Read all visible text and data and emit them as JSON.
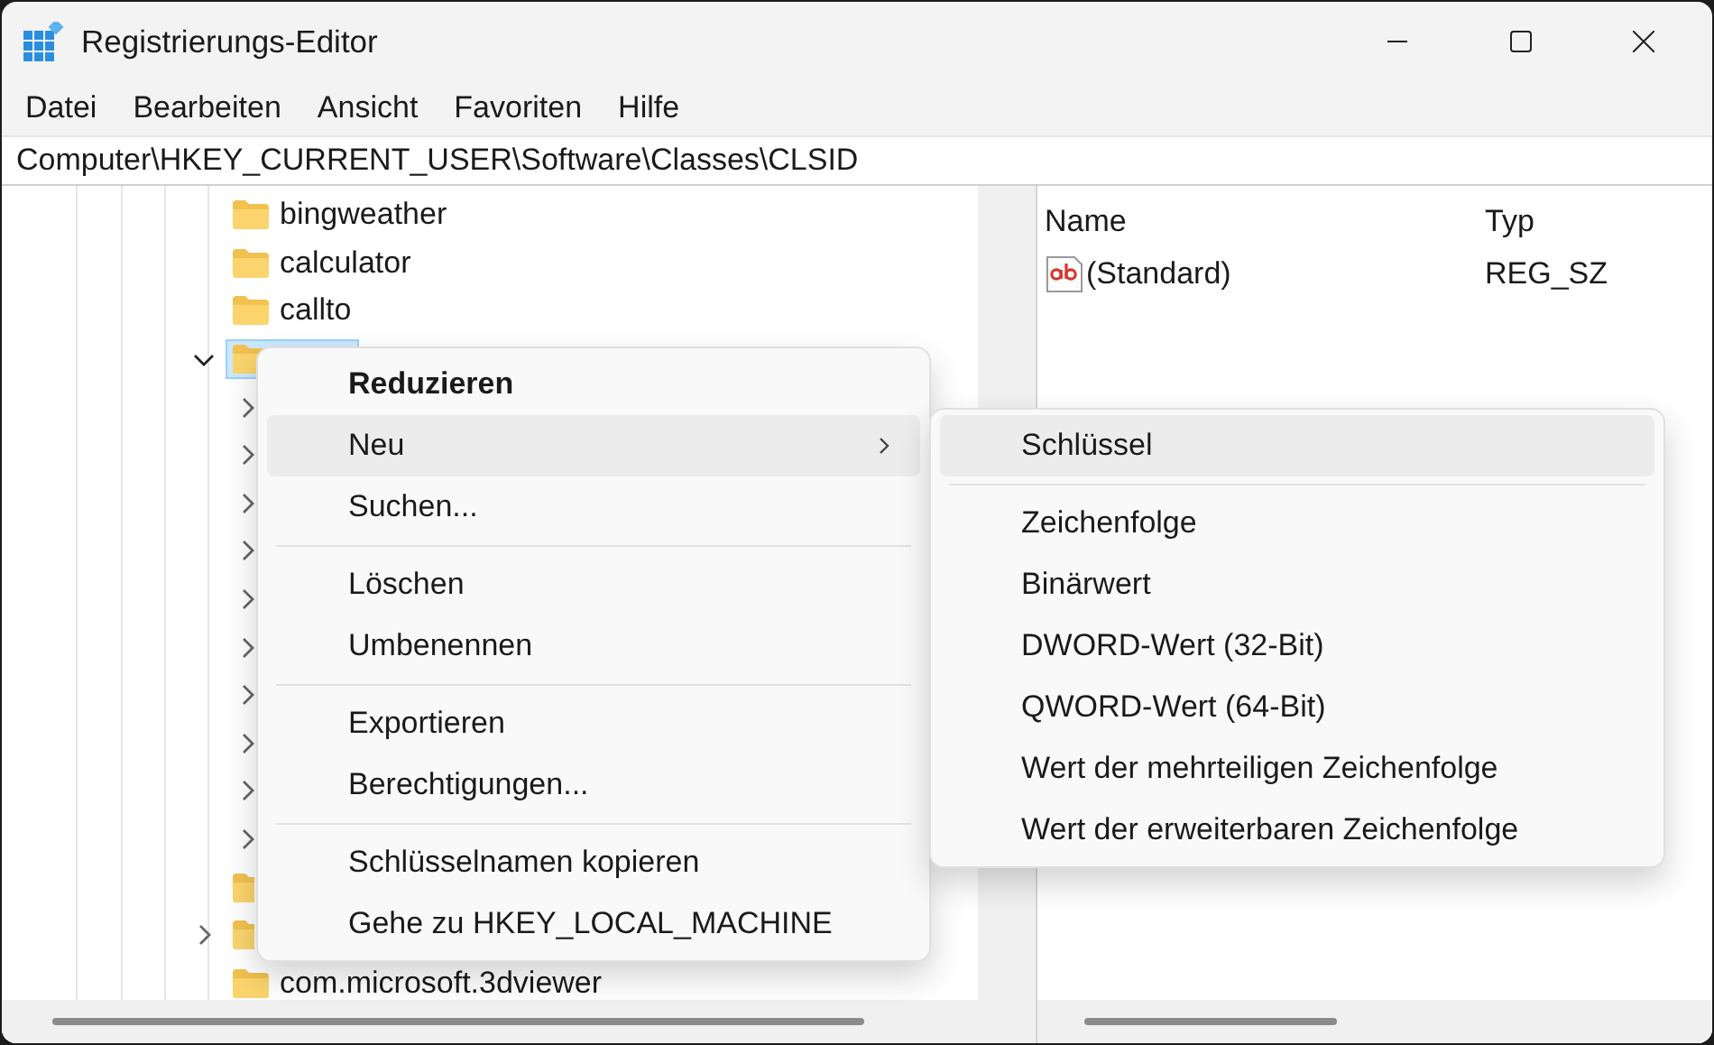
{
  "window": {
    "title": "Registrierungs-Editor"
  },
  "menu_bar": [
    "Datei",
    "Bearbeiten",
    "Ansicht",
    "Favoriten",
    "Hilfe"
  ],
  "address": "Computer\\HKEY_CURRENT_USER\\Software\\Classes\\CLSID",
  "tree": {
    "items": [
      {
        "label": "bingweather",
        "selected": false
      },
      {
        "label": "calculator",
        "selected": false
      },
      {
        "label": "callto",
        "selected": false
      },
      {
        "selected": true,
        "expanded": true,
        "children": [
          {
            "expanded": false
          },
          {
            "expanded": false
          },
          {
            "expanded": false
          },
          {
            "expanded": false
          },
          {
            "expanded": false
          },
          {
            "expanded": false
          },
          {
            "expanded": false
          },
          {
            "expanded": false
          },
          {
            "expanded": false
          },
          {
            "expanded": false
          }
        ]
      },
      {
        "selected": false
      },
      {
        "selected": false,
        "expanded": false
      },
      {
        "label": "com.microsoft.3dviewer",
        "selected": false
      }
    ]
  },
  "values": {
    "columns": [
      "Name",
      "Typ"
    ],
    "rows": [
      {
        "name": "(Standard)",
        "type": "REG_SZ"
      }
    ]
  },
  "context_menu": {
    "items": [
      {
        "kind": "item",
        "label": "Reduzieren",
        "default": true,
        "selected": false
      },
      {
        "kind": "item",
        "label": "Neu",
        "submenu": true,
        "selected": true
      },
      {
        "kind": "item",
        "label": "Suchen...",
        "selected": false
      },
      {
        "kind": "separator"
      },
      {
        "kind": "item",
        "label": "Löschen",
        "selected": false
      },
      {
        "kind": "item",
        "label": "Umbenennen",
        "selected": false
      },
      {
        "kind": "separator"
      },
      {
        "kind": "item",
        "label": "Exportieren",
        "selected": false
      },
      {
        "kind": "item",
        "label": "Berechtigungen...",
        "selected": false
      },
      {
        "kind": "separator"
      },
      {
        "kind": "item",
        "label": "Schlüsselnamen kopieren",
        "selected": false
      },
      {
        "kind": "item",
        "label": "Gehe zu HKEY_LOCAL_MACHINE",
        "selected": false
      }
    ]
  },
  "submenu": {
    "items": [
      {
        "kind": "item",
        "label": "Schlüssel",
        "selected": true
      },
      {
        "kind": "separator"
      },
      {
        "kind": "item",
        "label": "Zeichenfolge",
        "selected": false
      },
      {
        "kind": "item",
        "label": "Binärwert",
        "selected": false
      },
      {
        "kind": "item",
        "label": "DWORD-Wert (32-Bit)",
        "selected": false
      },
      {
        "kind": "item",
        "label": "QWORD-Wert (64-Bit)",
        "selected": false
      },
      {
        "kind": "item",
        "label": "Wert der mehrteiligen Zeichenfolge",
        "selected": false
      },
      {
        "kind": "item",
        "label": "Wert der erweiterbaren Zeichenfolge",
        "selected": false
      }
    ]
  }
}
